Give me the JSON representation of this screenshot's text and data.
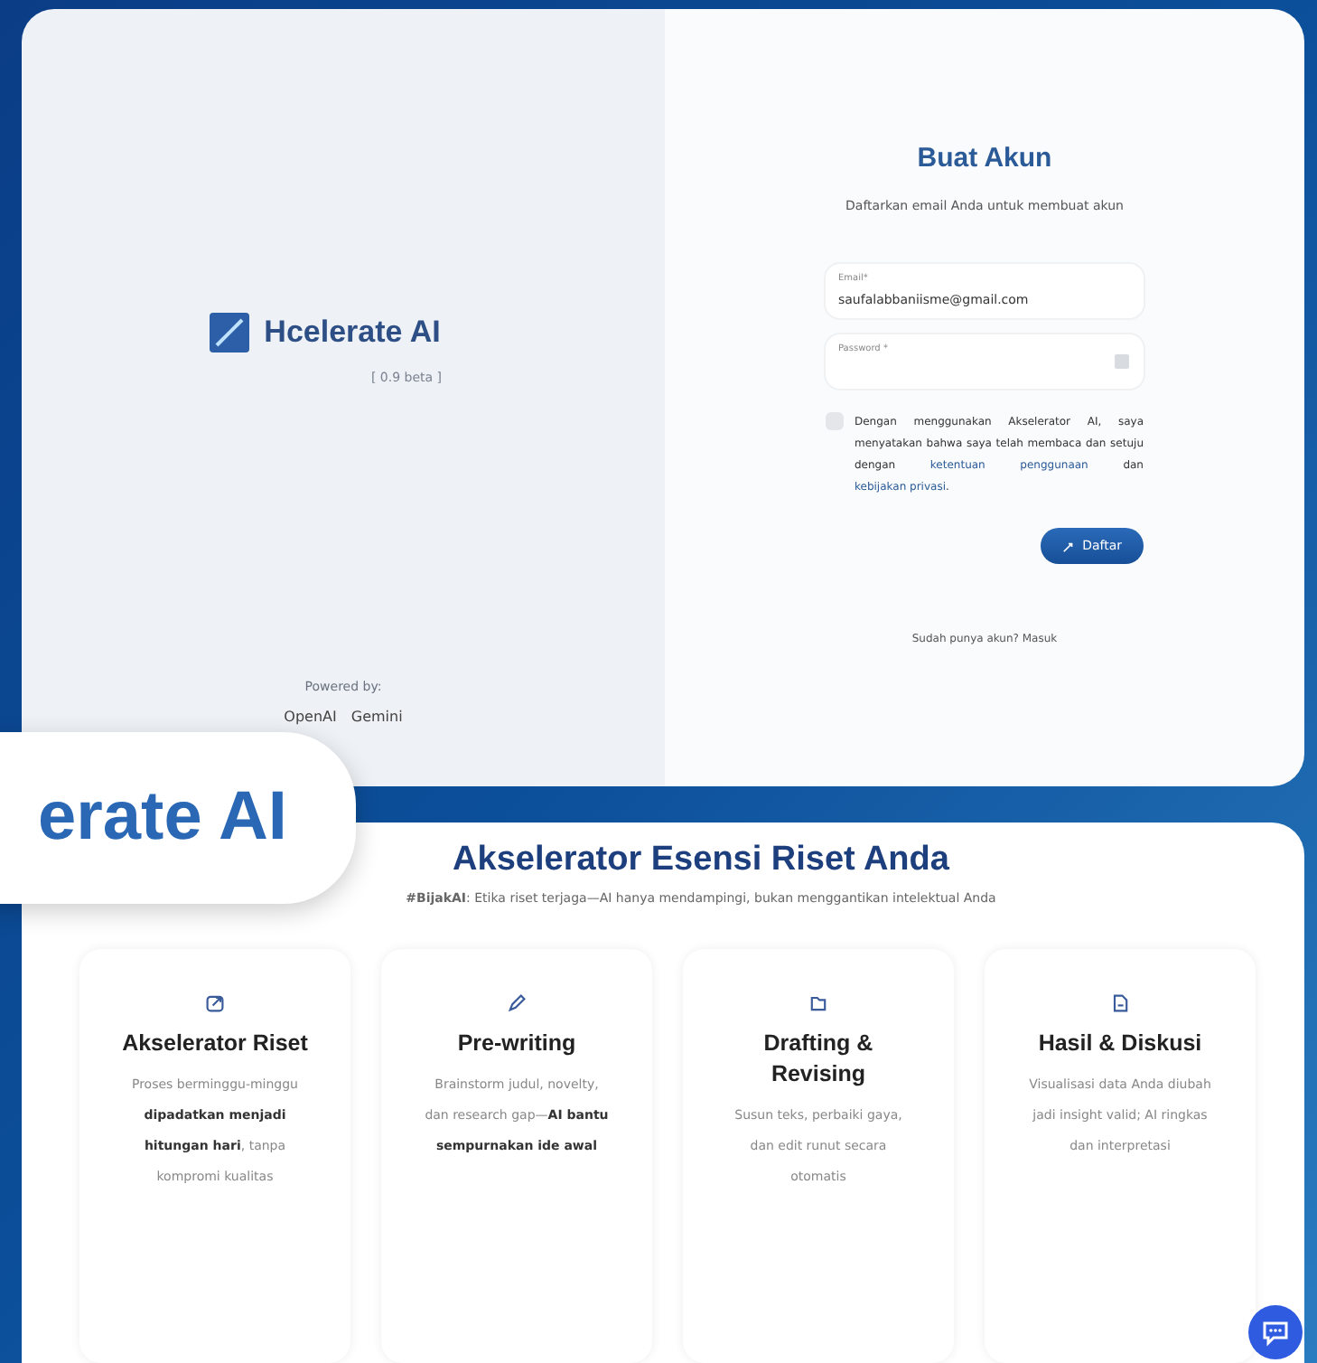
{
  "auth_panel": {
    "brand": {
      "name": "Hcelerate AI",
      "version": "[ 0.9 beta ]"
    },
    "powered_by": {
      "label": "Powered by:",
      "providers": [
        "OpenAI",
        "Gemini"
      ]
    },
    "form": {
      "title": "Buat Akun",
      "subtitle": "Daftarkan email Anda untuk membuat akun",
      "fields": [
        {
          "label": "Email*",
          "value": "saufalabbaniisme@gmail.com",
          "kind": "text"
        },
        {
          "label": "Password *",
          "kind": "password"
        }
      ],
      "terms": {
        "checked": false,
        "parts": [
          {
            "kind": "text",
            "text": "Dengan menggunakan Akselerator AI, saya menyatakan bahwa saya telah membaca dan setuju dengan"
          },
          {
            "kind": "link",
            "text": "ketentuan penggunaan"
          },
          {
            "kind": "text",
            "text": "dan"
          },
          {
            "kind": "link",
            "text": "kebijakan privasi"
          },
          {
            "kind": "text",
            "text": "."
          }
        ]
      },
      "submit": "Daftar",
      "login_prompt": "Sudah punya akun? Masuk"
    }
  },
  "brand_badge": "erate AI",
  "features": {
    "title": "Akselerator Esensi Riset Anda",
    "tagline": "**#BijakAI**: Etika riset terjaga—AI hanya mendampingi, bukan menggantikan intelektual Anda",
    "cards": [
      {
        "kind": "export",
        "title": "Akselerator Riset",
        "text": "Proses berminggu-minggu **dipadatkan menjadi hitungan hari**, tanpa kompromi kualitas"
      },
      {
        "kind": "pencil",
        "title": "Pre-writing",
        "text": "Brainstorm judul, novelty, dan research gap—**AI bantu sempurnakan ide awal**"
      },
      {
        "kind": "folder",
        "title": "Drafting & Revising",
        "text": "Susun teks, perbaiki gaya, dan edit runut secara otomatis"
      },
      {
        "kind": "file",
        "title": "Hasil & Diskusi",
        "text": "Visualisasi data Anda diubah jadi insight valid; AI ringkas dan interpretasi"
      }
    ]
  }
}
